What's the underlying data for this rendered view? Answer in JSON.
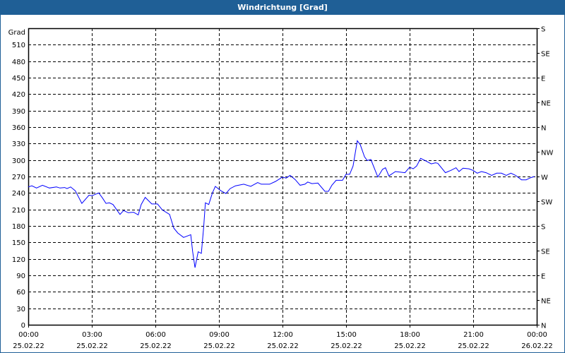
{
  "window": {
    "title": "Windrichtung [Grad]"
  },
  "chart_data": {
    "type": "line",
    "title": "Windrichtung [Grad]",
    "ylabel": "Grad",
    "xlabel": "",
    "ylim": [
      0,
      540
    ],
    "xlim_hours": [
      0,
      24
    ],
    "y_ticks": [
      0,
      30,
      60,
      90,
      120,
      150,
      180,
      210,
      240,
      270,
      300,
      330,
      360,
      390,
      420,
      450,
      480,
      510
    ],
    "right_axis": {
      "labels": [
        "N",
        "NE",
        "E",
        "SE",
        "S",
        "SW",
        "W",
        "NW",
        "N",
        "NE",
        "E",
        "SE",
        "S"
      ],
      "values": [
        0,
        45,
        90,
        135,
        180,
        225,
        270,
        315,
        360,
        405,
        450,
        495,
        540
      ]
    },
    "x_ticks": [
      {
        "hour": 0,
        "time": "00:00",
        "date": "25.02.22"
      },
      {
        "hour": 3,
        "time": "03:00",
        "date": "25.02.22"
      },
      {
        "hour": 6,
        "time": "06:00",
        "date": "25.02.22"
      },
      {
        "hour": 9,
        "time": "09:00",
        "date": "25.02.22"
      },
      {
        "hour": 12,
        "time": "12:00",
        "date": "25.02.22"
      },
      {
        "hour": 15,
        "time": "15:00",
        "date": "25.02.22"
      },
      {
        "hour": 18,
        "time": "18:00",
        "date": "25.02.22"
      },
      {
        "hour": 21,
        "time": "21:00",
        "date": "25.02.22"
      },
      {
        "hour": 24,
        "time": "00:00",
        "date": "26.02.22"
      }
    ],
    "grid": true,
    "colors": {
      "line": "#0000ff",
      "title_bar": "#1f5f96"
    },
    "series": [
      {
        "name": "Windrichtung",
        "x_hours": [
          0,
          0.17,
          0.39,
          0.67,
          1,
          1.33,
          1.5,
          1.72,
          1.83,
          2,
          2.22,
          2.53,
          2.87,
          3,
          3.33,
          3.5,
          3.67,
          3.83,
          4,
          4.33,
          4.5,
          4.72,
          4.97,
          5.19,
          5.33,
          5.52,
          5.83,
          6.1,
          6.33,
          6.67,
          6.87,
          7.06,
          7.33,
          7.67,
          7.76,
          7.87,
          8.02,
          8.17,
          8.28,
          8.36,
          8.52,
          8.69,
          8.83,
          9.09,
          9.33,
          9.53,
          9.78,
          10.17,
          10.5,
          10.83,
          11,
          11.39,
          11.67,
          12,
          12.17,
          12.36,
          12.61,
          12.83,
          13.06,
          13.19,
          13.39,
          13.67,
          14,
          14.17,
          14.33,
          14.53,
          14.83,
          15,
          15.17,
          15.33,
          15.53,
          15.67,
          15.87,
          16,
          16.17,
          16.5,
          16.72,
          16.86,
          17.02,
          17.33,
          17.78,
          18,
          18.17,
          18.33,
          18.52,
          18.78,
          19.02,
          19.22,
          19.33,
          19.69,
          19.94,
          20.19,
          20.33,
          20.52,
          20.8,
          21,
          21.19,
          21.39,
          21.61,
          21.87,
          22.11,
          22.33,
          22.56,
          22.78,
          23,
          23.28,
          23.5,
          23.72,
          23.89
        ],
        "values": [
          251,
          253,
          249,
          254,
          249,
          251,
          249,
          250,
          248,
          251,
          244,
          221,
          236,
          235,
          240,
          231,
          221,
          222,
          219,
          201,
          208,
          204,
          205,
          200,
          219,
          232,
          220,
          220,
          209,
          201,
          176,
          167,
          159,
          164,
          133,
          104,
          133,
          130,
          178,
          222,
          219,
          240,
          252,
          244,
          239,
          248,
          253,
          256,
          252,
          259,
          256,
          256,
          261,
          269,
          267,
          272,
          264,
          254,
          256,
          260,
          257,
          258,
          243,
          243,
          254,
          263,
          263,
          274,
          274,
          289,
          335,
          328,
          306,
          299,
          301,
          269,
          283,
          286,
          271,
          279,
          277,
          287,
          284,
          289,
          303,
          298,
          293,
          295,
          294,
          277,
          281,
          286,
          279,
          285,
          284,
          281,
          276,
          279,
          277,
          272,
          276,
          276,
          272,
          276,
          272,
          264,
          264,
          268,
          270
        ]
      }
    ]
  }
}
